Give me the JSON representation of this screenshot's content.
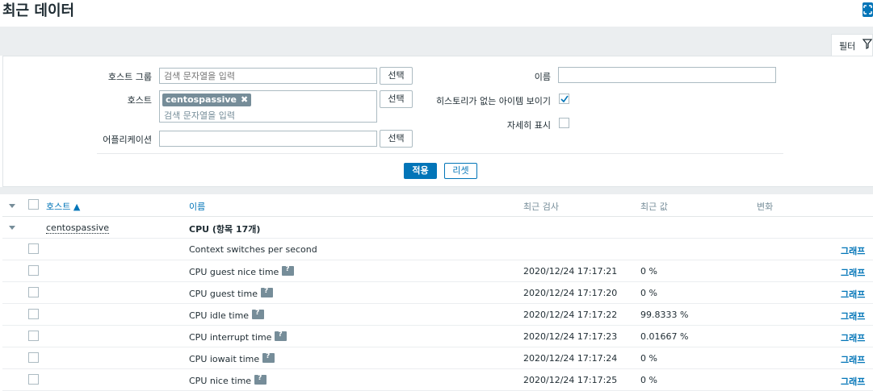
{
  "page": {
    "title": "최근 데이터"
  },
  "filter": {
    "tab_label": "필터",
    "host_group": {
      "label": "호스트 그룹",
      "placeholder": "검색 문자열을 입력",
      "select_label": "선택"
    },
    "host": {
      "label": "호스트",
      "tag": "centospassive",
      "placeholder": "검색 문자열을 입력",
      "select_label": "선택"
    },
    "application": {
      "label": "어플리케이션",
      "value": "",
      "select_label": "선택"
    },
    "name": {
      "label": "이름",
      "value": ""
    },
    "show_without_history": {
      "label": "히스토리가 없는 아이템 보이기",
      "checked": true
    },
    "show_details": {
      "label": "자세히 표시",
      "checked": false
    },
    "apply_label": "적용",
    "reset_label": "리셋"
  },
  "table": {
    "columns": {
      "host": "호스트 ▲",
      "name": "이름",
      "last_check": "최근 검사",
      "last_value": "최근 값",
      "change": "변화"
    },
    "group": {
      "host": "centospassive",
      "name": "CPU (항목 17개)"
    },
    "rows": [
      {
        "name": "Context switches per second",
        "info": false,
        "last_check": "",
        "last_value": "",
        "action": "그래프"
      },
      {
        "name": "CPU guest nice time",
        "info": true,
        "last_check": "2020/12/24 17:17:21",
        "last_value": "0 %",
        "action": "그래프"
      },
      {
        "name": "CPU guest time",
        "info": true,
        "last_check": "2020/12/24 17:17:20",
        "last_value": "0 %",
        "action": "그래프"
      },
      {
        "name": "CPU idle time",
        "info": true,
        "last_check": "2020/12/24 17:17:22",
        "last_value": "99.8333 %",
        "action": "그래프"
      },
      {
        "name": "CPU interrupt time",
        "info": true,
        "last_check": "2020/12/24 17:17:23",
        "last_value": "0.01667 %",
        "action": "그래프"
      },
      {
        "name": "CPU iowait time",
        "info": true,
        "last_check": "2020/12/24 17:17:24",
        "last_value": "0 %",
        "action": "그래프"
      },
      {
        "name": "CPU nice time",
        "info": true,
        "last_check": "2020/12/24 17:17:25",
        "last_value": "0 %",
        "action": "그래프"
      }
    ]
  },
  "colors": {
    "accent": "#0275b8",
    "text": "#1f2c33",
    "muted": "#768d99",
    "bar": "#ebeef0"
  }
}
